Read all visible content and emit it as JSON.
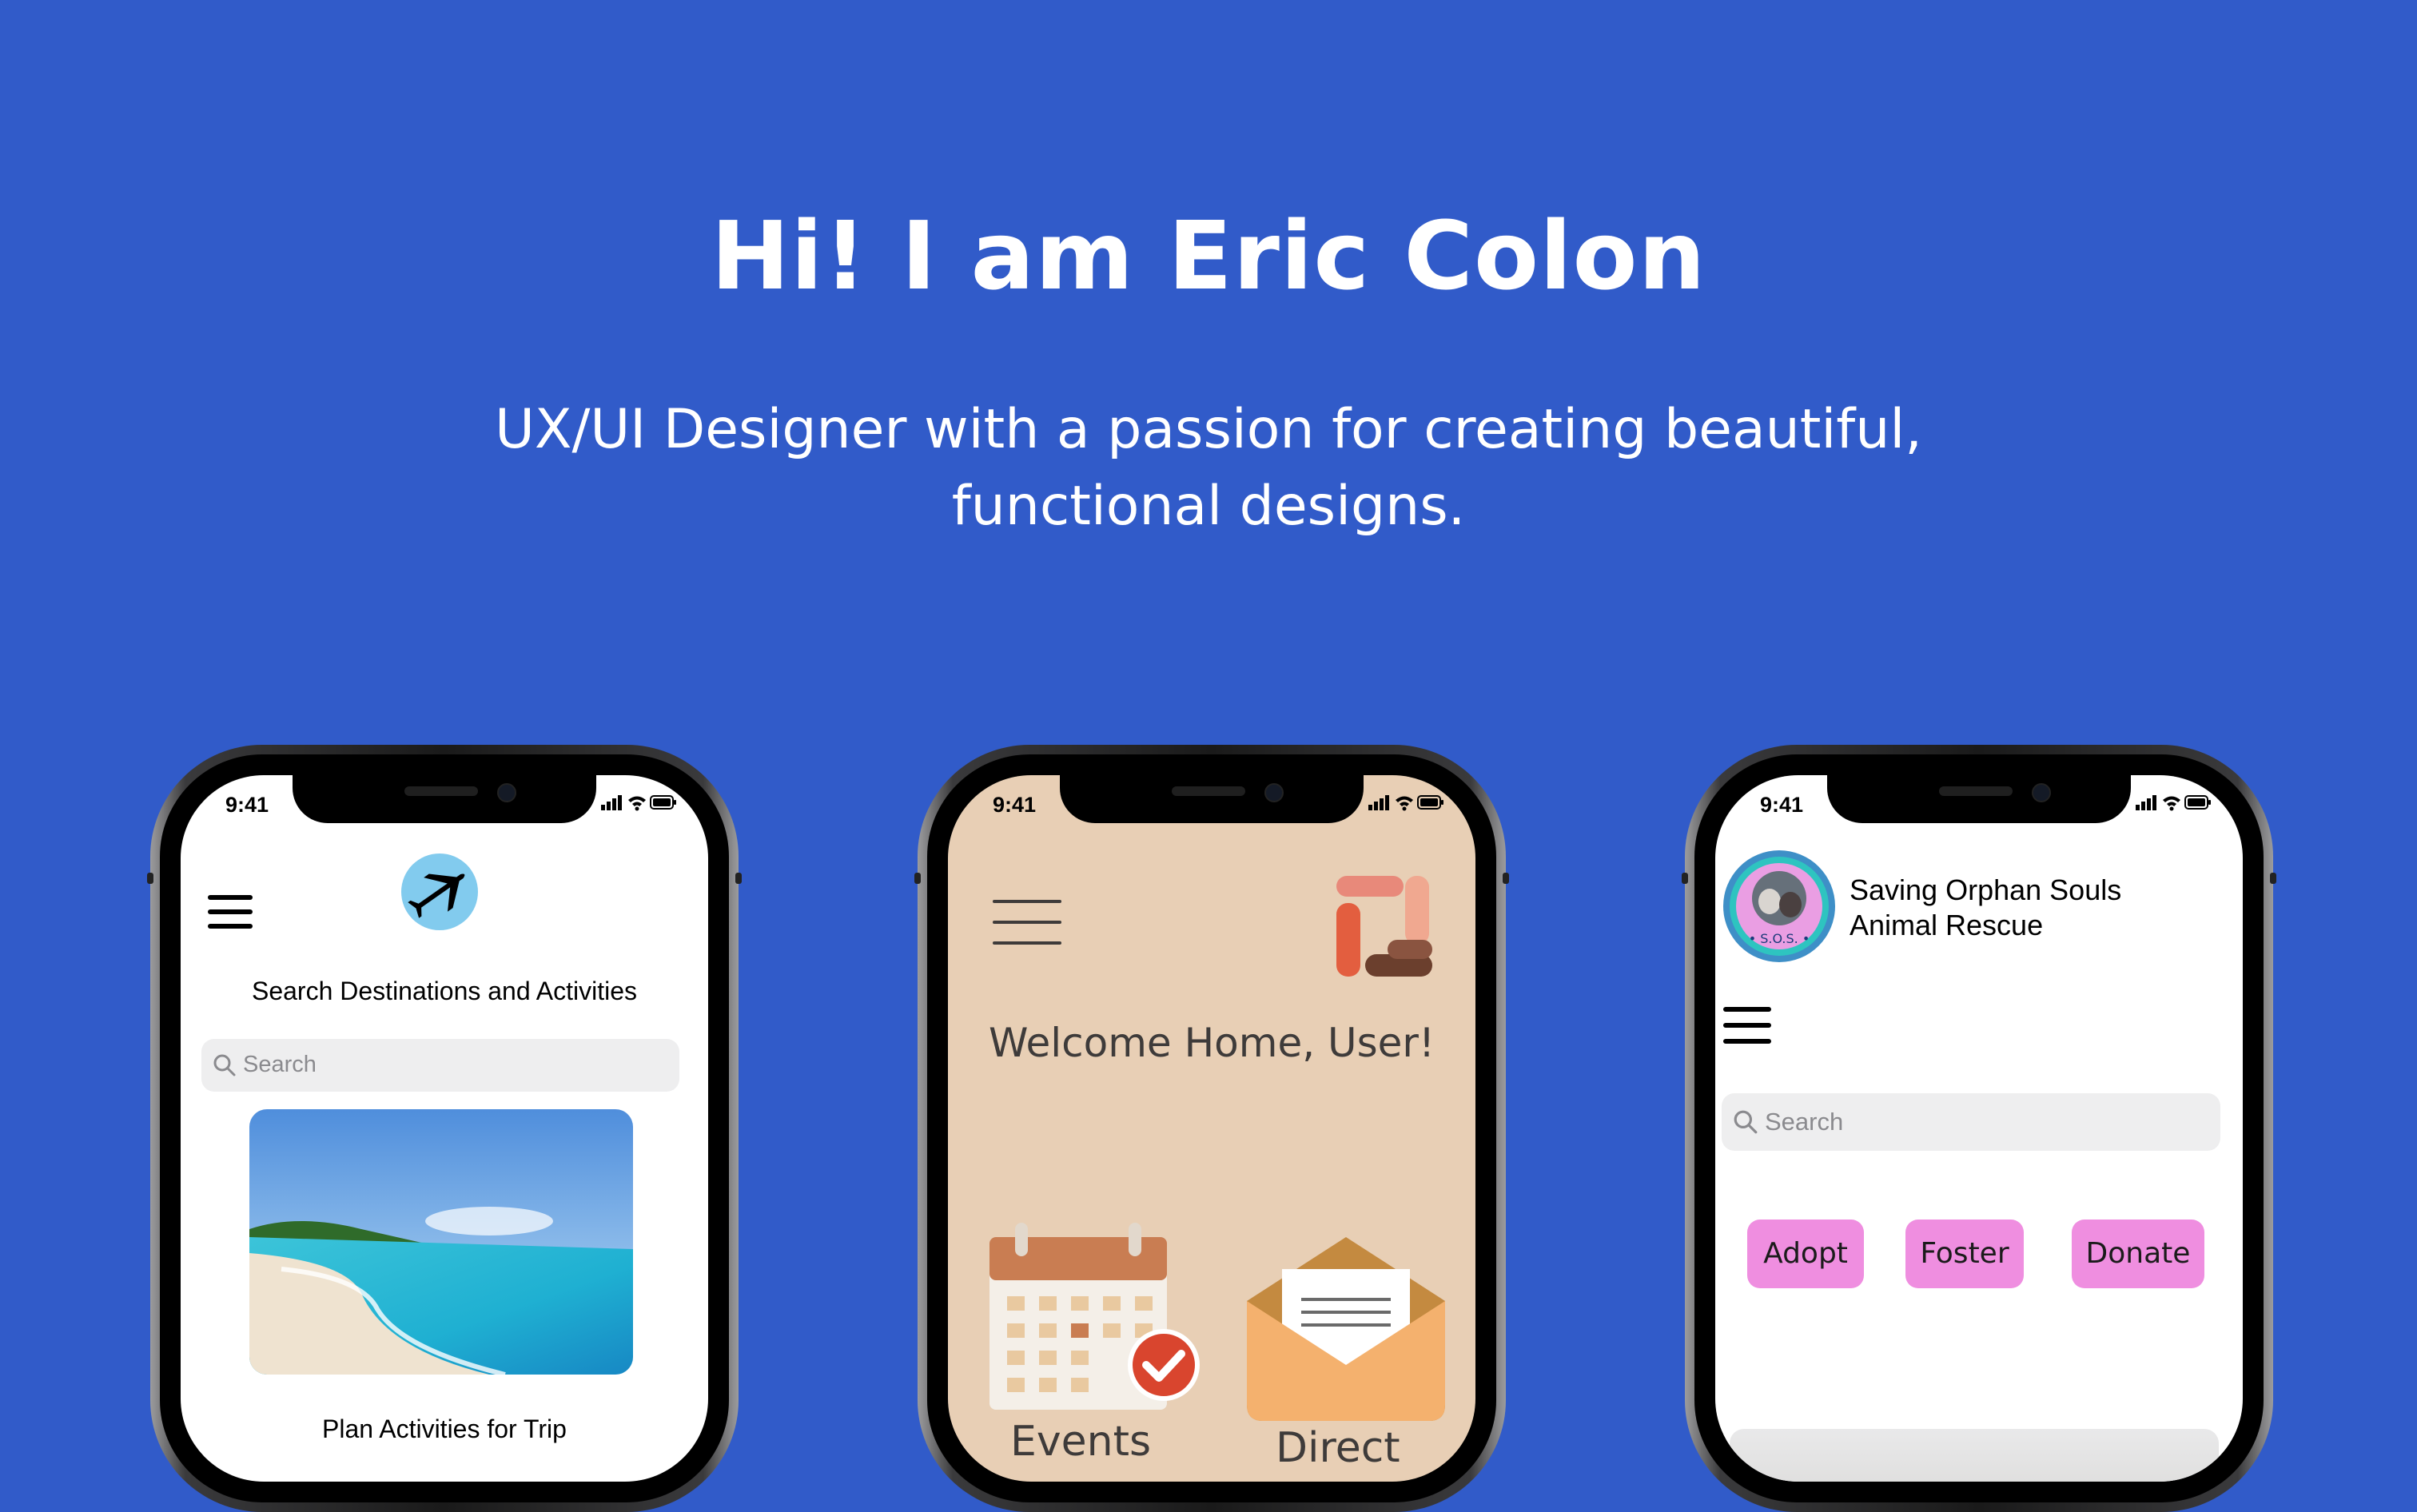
{
  "hero": {
    "title": "Hi! I am Eric Colon",
    "subtitle_line1": "UX/UI Designer with a passion for creating beautiful,",
    "subtitle_line2": "functional designs."
  },
  "colors": {
    "background": "#315bc9",
    "travel_logo": "#82cbee",
    "home_bg": "#e8cfb5",
    "pill": "#ef8ee0"
  },
  "phones": [
    {
      "status_time": "9:41",
      "logo_icon": "airplane-icon",
      "heading": "Search Destinations and Activities",
      "search_placeholder": "Search",
      "image": "beach-photo",
      "caption": "Plan Activities for Trip"
    },
    {
      "status_time": "9:41",
      "logo_icon": "hands-together-icon",
      "welcome": "Welcome Home, User!",
      "tiles": [
        {
          "label": "Events",
          "icon": "calendar-check-icon"
        },
        {
          "label": "Direct",
          "icon": "envelope-icon"
        }
      ]
    },
    {
      "status_time": "9:41",
      "logo_icon": "sos-logo-icon",
      "org_line1": "Saving Orphan Souls",
      "org_line2": "Animal Rescue",
      "search_placeholder": "Search",
      "buttons": [
        "Adopt",
        "Foster",
        "Donate"
      ]
    }
  ]
}
